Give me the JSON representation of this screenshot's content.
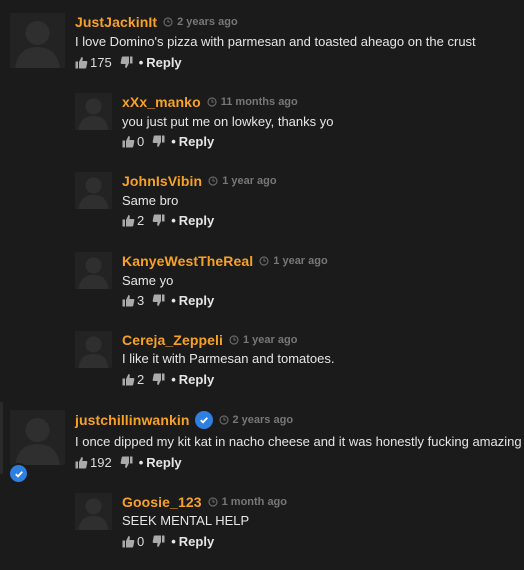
{
  "comments": [
    {
      "username": "JustJackinIt",
      "time": "2 years ago",
      "text": "I love Domino's pizza with parmesan and toasted aheago on the crust",
      "likes": "175",
      "reply": "Reply",
      "verified": false
    },
    {
      "username": "xXx_manko",
      "time": "11 months ago",
      "text": "you just put me on lowkey, thanks yo",
      "likes": "0",
      "reply": "Reply",
      "verified": false
    },
    {
      "username": "JohnIsVibin",
      "time": "1 year ago",
      "text": "Same bro",
      "likes": "2",
      "reply": "Reply",
      "verified": false
    },
    {
      "username": "KanyeWestTheReal",
      "time": "1 year ago",
      "text": "Same yo",
      "likes": "3",
      "reply": "Reply",
      "verified": false
    },
    {
      "username": "Cereja_Zeppeli",
      "time": "1 year ago",
      "text": "I like it with Parmesan and tomatoes.",
      "likes": "2",
      "reply": "Reply",
      "verified": false
    },
    {
      "username": "justchillinwankin",
      "time": "2 years ago",
      "text": "I once dipped my kit kat in nacho cheese and it was honestly fucking amazing",
      "likes": "192",
      "reply": "Reply",
      "verified": true
    },
    {
      "username": "Goosie_123",
      "time": "1 month ago",
      "text": "SEEK MENTAL HELP",
      "likes": "0",
      "reply": "Reply",
      "verified": false
    }
  ],
  "colors": {
    "background": "#1b1b1b",
    "username": "#f7a226",
    "time": "#777777",
    "verified": "#2f7fe0"
  },
  "icons": {
    "avatar": "default-user-silhouette",
    "clock": "clock-icon",
    "like": "thumbs-up-icon",
    "dislike": "thumbs-down-icon",
    "verified": "checkmark-badge-icon"
  }
}
